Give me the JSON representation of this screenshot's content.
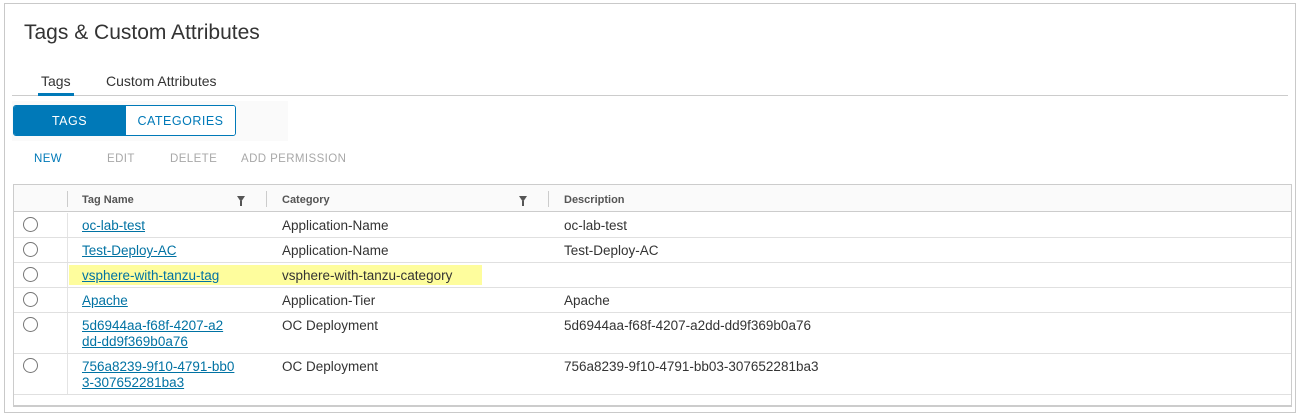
{
  "page": {
    "title": "Tags & Custom Attributes"
  },
  "tabs": [
    {
      "label": "Tags",
      "active": true
    },
    {
      "label": "Custom Attributes",
      "active": false
    }
  ],
  "segmented": {
    "tags_label": "TAGS",
    "categories_label": "CATEGORIES",
    "selected": "TAGS"
  },
  "actions": {
    "new": "NEW",
    "edit": "EDIT",
    "delete": "DELETE",
    "add_permission": "ADD PERMISSION"
  },
  "grid": {
    "columns": [
      "Tag Name",
      "Category",
      "Description"
    ],
    "rows": [
      {
        "tag_name": "oc-lab-test",
        "category": "Application-Name",
        "description": "oc-lab-test"
      },
      {
        "tag_name": "Test-Deploy-AC",
        "category": "Application-Name",
        "description": "Test-Deploy-AC"
      },
      {
        "tag_name": "vsphere-with-tanzu-tag",
        "category": "vsphere-with-tanzu-category",
        "description": "",
        "highlighted": true
      },
      {
        "tag_name": "Apache",
        "category": "Application-Tier",
        "description": "Apache"
      },
      {
        "tag_name_line1": "5d6944aa-f68f-4207-a2",
        "tag_name_line2": "dd-dd9f369b0a76",
        "category": "OC Deployment",
        "description": "5d6944aa-f68f-4207-a2dd-dd9f369b0a76"
      },
      {
        "tag_name_line1": "756a8239-9f10-4791-bb0",
        "tag_name_line2": "3-307652281ba3",
        "category": "OC Deployment",
        "description": "756a8239-9f10-4791-bb03-307652281ba3"
      }
    ]
  },
  "colors": {
    "accent": "#0079b8",
    "link": "#0072a3",
    "highlight": "#fefd9d",
    "disabled": "#a8a8a8"
  }
}
